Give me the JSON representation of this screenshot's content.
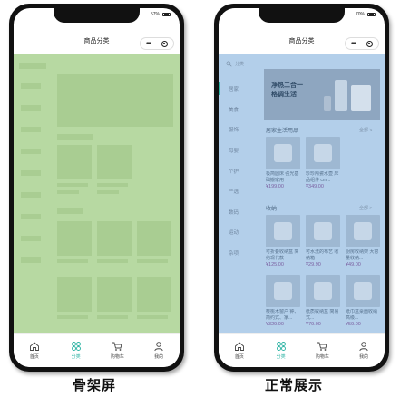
{
  "left_phone": {
    "status": {
      "battery": "57%"
    },
    "header": {
      "title": "商品分类"
    },
    "tabs": [
      {
        "label": "首页",
        "icon": "home-icon"
      },
      {
        "label": "分类",
        "icon": "category-icon"
      },
      {
        "label": "购物车",
        "icon": "cart-icon"
      },
      {
        "label": "我的",
        "icon": "user-icon"
      }
    ],
    "caption": "骨架屏"
  },
  "right_phone": {
    "status": {
      "battery": "70%"
    },
    "header": {
      "title": "商品分类"
    },
    "search": {
      "placeholder": "分类"
    },
    "categories": [
      "居家",
      "美食",
      "服饰",
      "母婴",
      "个护",
      "严选",
      "数码",
      "运动",
      "杂项"
    ],
    "active_category_index": 0,
    "banner": {
      "line1": "净热二合一",
      "line2": "格调生活"
    },
    "section1": {
      "title": "居家生活用品",
      "more": "全部 >"
    },
    "section2": {
      "title": "收纳",
      "more": "全部 >"
    },
    "products_row1": [
      {
        "name": "极简圆床 强光基础搬家用",
        "price": "¥199.00"
      },
      {
        "name": "珍珍陶瓷水壶 床品组件 cm...",
        "price": "¥349.00"
      }
    ],
    "products_row2": [
      {
        "name": "可折叠收纳盒 简约现代款",
        "price": "¥125.00"
      },
      {
        "name": "可水洗的布艺 收纳箱",
        "price": "¥29.90"
      },
      {
        "name": "厨房收纳架 大容量收纳...",
        "price": "¥49.00"
      }
    ],
    "products_row3": [
      {
        "name": "樱桃木窗户 钟、简约式、家...",
        "price": "¥329.00"
      },
      {
        "name": "纸质收纳盒 简易式...",
        "price": "¥79.00"
      },
      {
        "name": "纸巾盒桌面收纳 高级...",
        "price": "¥59.00"
      }
    ],
    "tabs": [
      {
        "label": "首页",
        "icon": "home-icon"
      },
      {
        "label": "分类",
        "icon": "category-icon"
      },
      {
        "label": "购物车",
        "icon": "cart-icon"
      },
      {
        "label": "我的",
        "icon": "user-icon"
      }
    ],
    "caption": "正常展示"
  },
  "colors": {
    "skeleton_overlay": "#b7d9a2",
    "normal_overlay": "#b3cfea",
    "accent": "#2bb3a3"
  }
}
